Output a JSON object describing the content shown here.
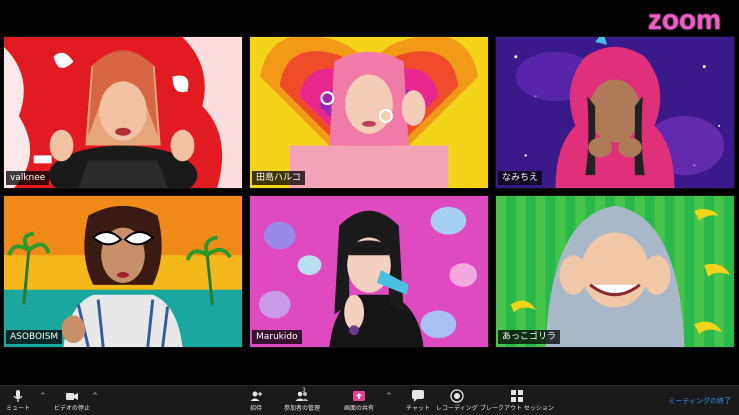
{
  "app": {
    "logo": "zoom",
    "logo_color": "#f25ac8",
    "view": "gallery"
  },
  "participants": [
    {
      "name": "valknee",
      "background": "red-white-splash"
    },
    {
      "name": "田島ハルコ",
      "background": "rainbow-heart"
    },
    {
      "name": "なみちえ",
      "background": "purple-galaxy"
    },
    {
      "name": "ASOBOISM",
      "background": "orange-palm-beach"
    },
    {
      "name": "Marukido",
      "background": "pink-pills"
    },
    {
      "name": "あっこゴリラ",
      "background": "green-bananas"
    }
  ],
  "toolbar": {
    "mute": {
      "label": "ミュート",
      "icon": "microphone-icon"
    },
    "video": {
      "label": "ビデオの停止",
      "icon": "video-camera-icon"
    },
    "invite": {
      "label": "招待",
      "icon": "invite-person-icon"
    },
    "participants": {
      "label": "参加者の管理",
      "count": "3",
      "icon": "participants-icon"
    },
    "share": {
      "label": "画面の共有",
      "icon": "share-screen-icon",
      "color": "#e93f9b"
    },
    "chat": {
      "label": "チャット",
      "icon": "chat-bubble-icon"
    },
    "record": {
      "label": "レコーディング",
      "icon": "record-icon"
    },
    "breakout": {
      "label": "ブレークアウト セッション",
      "icon": "breakout-rooms-icon"
    },
    "end": {
      "label": "ミーティングの終了",
      "color": "#3b8ef2"
    }
  }
}
